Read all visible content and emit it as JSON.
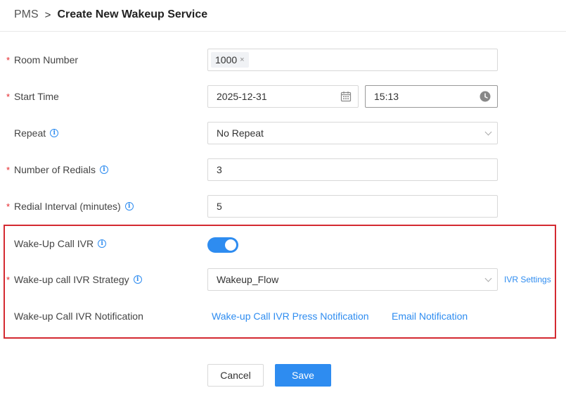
{
  "breadcrumb": {
    "parent": "PMS",
    "separator": ">",
    "current": "Create New Wakeup Service"
  },
  "form": {
    "room_number": {
      "label": "Room Number",
      "required": true,
      "tags": [
        "1000"
      ],
      "tag_remove": "×"
    },
    "start_time": {
      "label": "Start Time",
      "required": true,
      "date": "2025-12-31",
      "time": "15:13"
    },
    "repeat": {
      "label": "Repeat",
      "required": false,
      "value": "No Repeat"
    },
    "redials": {
      "label": "Number of Redials",
      "required": true,
      "value": "3"
    },
    "redial_interval": {
      "label": "Redial Interval (minutes)",
      "required": true,
      "value": "5"
    },
    "ivr": {
      "label": "Wake-Up Call IVR",
      "enabled": true
    },
    "ivr_strategy": {
      "label": "Wake-up call IVR Strategy",
      "required": true,
      "value": "Wakeup_Flow",
      "settings_link": "IVR Settings"
    },
    "ivr_notification": {
      "label": "Wake-up Call IVR Notification",
      "press_link": "Wake-up Call IVR Press Notification",
      "email_link": "Email Notification"
    }
  },
  "buttons": {
    "cancel": "Cancel",
    "save": "Save"
  },
  "info_glyph": "i",
  "required_glyph": "*",
  "colors": {
    "accent": "#2e8cf0",
    "required": "#e5262a",
    "highlight": "#d42a31"
  },
  "icons": [
    "calendar-icon",
    "clock-icon",
    "chevron-down-icon",
    "info-icon"
  ]
}
